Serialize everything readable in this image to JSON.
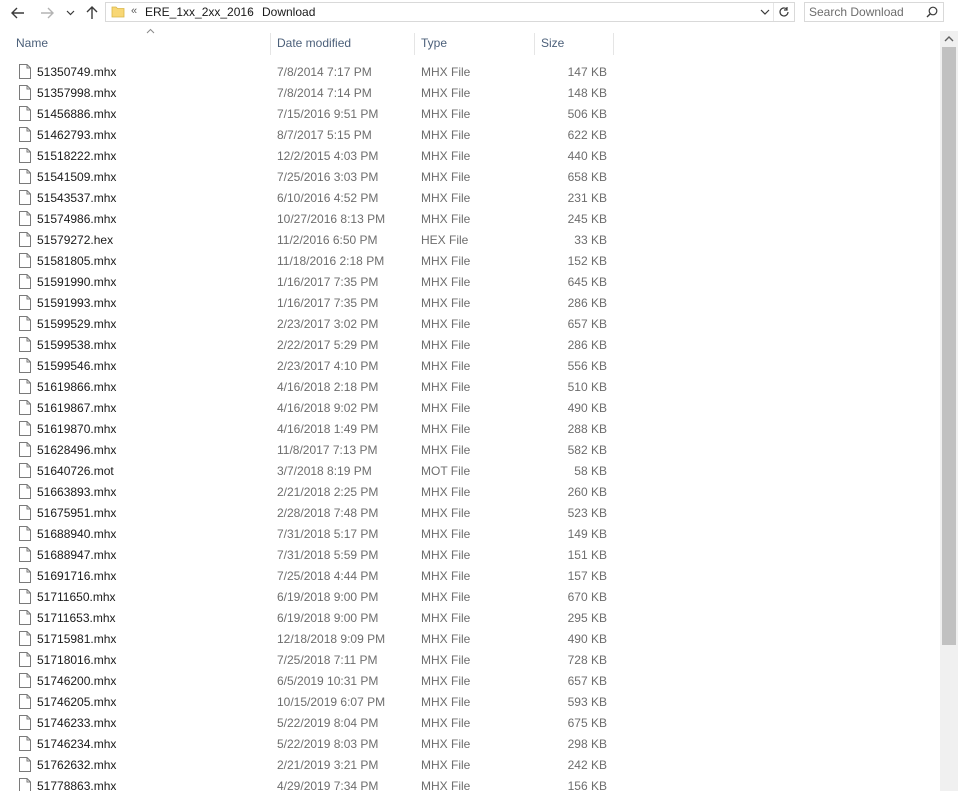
{
  "address_bar": {
    "overflow_label": "«",
    "path": [
      "ERE_1xx_2xx_2016",
      "Download"
    ],
    "separator": "›"
  },
  "search": {
    "placeholder": "Search Download"
  },
  "columns": {
    "name": "Name",
    "date": "Date modified",
    "type": "Type",
    "size": "Size"
  },
  "files": [
    {
      "name": "51350749.mhx",
      "date": "7/8/2014 7:17 PM",
      "type": "MHX File",
      "size": "147 KB"
    },
    {
      "name": "51357998.mhx",
      "date": "7/8/2014 7:14 PM",
      "type": "MHX File",
      "size": "148 KB"
    },
    {
      "name": "51456886.mhx",
      "date": "7/15/2016 9:51 PM",
      "type": "MHX File",
      "size": "506 KB"
    },
    {
      "name": "51462793.mhx",
      "date": "8/7/2017 5:15 PM",
      "type": "MHX File",
      "size": "622 KB"
    },
    {
      "name": "51518222.mhx",
      "date": "12/2/2015 4:03 PM",
      "type": "MHX File",
      "size": "440 KB"
    },
    {
      "name": "51541509.mhx",
      "date": "7/25/2016 3:03 PM",
      "type": "MHX File",
      "size": "658 KB"
    },
    {
      "name": "51543537.mhx",
      "date": "6/10/2016 4:52 PM",
      "type": "MHX File",
      "size": "231 KB"
    },
    {
      "name": "51574986.mhx",
      "date": "10/27/2016 8:13 PM",
      "type": "MHX File",
      "size": "245 KB"
    },
    {
      "name": "51579272.hex",
      "date": "11/2/2016 6:50 PM",
      "type": "HEX File",
      "size": "33 KB"
    },
    {
      "name": "51581805.mhx",
      "date": "11/18/2016 2:18 PM",
      "type": "MHX File",
      "size": "152 KB"
    },
    {
      "name": "51591990.mhx",
      "date": "1/16/2017 7:35 PM",
      "type": "MHX File",
      "size": "645 KB"
    },
    {
      "name": "51591993.mhx",
      "date": "1/16/2017 7:35 PM",
      "type": "MHX File",
      "size": "286 KB"
    },
    {
      "name": "51599529.mhx",
      "date": "2/23/2017 3:02 PM",
      "type": "MHX File",
      "size": "657 KB"
    },
    {
      "name": "51599538.mhx",
      "date": "2/22/2017 5:29 PM",
      "type": "MHX File",
      "size": "286 KB"
    },
    {
      "name": "51599546.mhx",
      "date": "2/23/2017 4:10 PM",
      "type": "MHX File",
      "size": "556 KB"
    },
    {
      "name": "51619866.mhx",
      "date": "4/16/2018 2:18 PM",
      "type": "MHX File",
      "size": "510 KB"
    },
    {
      "name": "51619867.mhx",
      "date": "4/16/2018 9:02 PM",
      "type": "MHX File",
      "size": "490 KB"
    },
    {
      "name": "51619870.mhx",
      "date": "4/16/2018 1:49 PM",
      "type": "MHX File",
      "size": "288 KB"
    },
    {
      "name": "51628496.mhx",
      "date": "11/8/2017 7:13 PM",
      "type": "MHX File",
      "size": "582 KB"
    },
    {
      "name": "51640726.mot",
      "date": "3/7/2018 8:19 PM",
      "type": "MOT File",
      "size": "58 KB"
    },
    {
      "name": "51663893.mhx",
      "date": "2/21/2018 2:25 PM",
      "type": "MHX File",
      "size": "260 KB"
    },
    {
      "name": "51675951.mhx",
      "date": "2/28/2018 7:48 PM",
      "type": "MHX File",
      "size": "523 KB"
    },
    {
      "name": "51688940.mhx",
      "date": "7/31/2018 5:17 PM",
      "type": "MHX File",
      "size": "149 KB"
    },
    {
      "name": "51688947.mhx",
      "date": "7/31/2018 5:59 PM",
      "type": "MHX File",
      "size": "151 KB"
    },
    {
      "name": "51691716.mhx",
      "date": "7/25/2018 4:44 PM",
      "type": "MHX File",
      "size": "157 KB"
    },
    {
      "name": "51711650.mhx",
      "date": "6/19/2018 9:00 PM",
      "type": "MHX File",
      "size": "670 KB"
    },
    {
      "name": "51711653.mhx",
      "date": "6/19/2018 9:00 PM",
      "type": "MHX File",
      "size": "295 KB"
    },
    {
      "name": "51715981.mhx",
      "date": "12/18/2018 9:09 PM",
      "type": "MHX File",
      "size": "490 KB"
    },
    {
      "name": "51718016.mhx",
      "date": "7/25/2018 7:11 PM",
      "type": "MHX File",
      "size": "728 KB"
    },
    {
      "name": "51746200.mhx",
      "date": "6/5/2019 10:31 PM",
      "type": "MHX File",
      "size": "657 KB"
    },
    {
      "name": "51746205.mhx",
      "date": "10/15/2019 6:07 PM",
      "type": "MHX File",
      "size": "593 KB"
    },
    {
      "name": "51746233.mhx",
      "date": "5/22/2019 8:04 PM",
      "type": "MHX File",
      "size": "675 KB"
    },
    {
      "name": "51746234.mhx",
      "date": "5/22/2019 8:03 PM",
      "type": "MHX File",
      "size": "298 KB"
    },
    {
      "name": "51762632.mhx",
      "date": "2/21/2019 3:21 PM",
      "type": "MHX File",
      "size": "242 KB"
    },
    {
      "name": "51778863.mhx",
      "date": "4/29/2019 7:34 PM",
      "type": "MHX File",
      "size": "156 KB"
    }
  ],
  "icons": {
    "back": "arrow-left-icon",
    "forward": "arrow-right-icon",
    "recent": "chevron-down-icon",
    "up": "arrow-up-icon",
    "folder": "folder-icon",
    "refresh": "refresh-icon",
    "search": "search-icon",
    "file": "file-icon",
    "sort": "sort-up-icon"
  },
  "colors": {
    "header_text": "#4c607a",
    "muted_text": "#6d6d6d",
    "folder": "#f8d775"
  }
}
